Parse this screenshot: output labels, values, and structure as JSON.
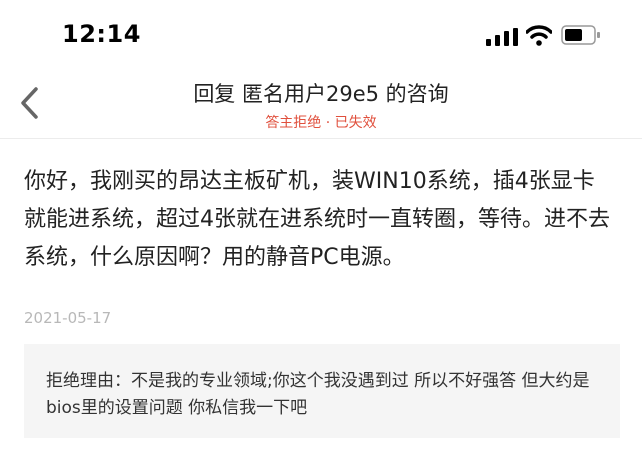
{
  "status_bar": {
    "time": "12:14"
  },
  "nav": {
    "title": "回复 匿名用户29e5 的咨询",
    "subtitle": "答主拒绝 · 已失效"
  },
  "question": {
    "text": "你好，我刚买的昂达主板矿机，装WIN10系统，插4张显卡就能进系统，超过4张就在进系统时一直转圈，等待。进不去系统，什么原因啊？用的静音PC电源。",
    "date": "2021-05-17"
  },
  "rejection": {
    "text": "拒绝理由：不是我的专业领域;你这个我没遇到过 所以不好强答 但大约是bios里的设置问题 你私信我一下吧"
  },
  "colors": {
    "status_red": "#e0503d",
    "date_gray": "#b8b8b8",
    "box_bg": "#f5f5f5"
  }
}
